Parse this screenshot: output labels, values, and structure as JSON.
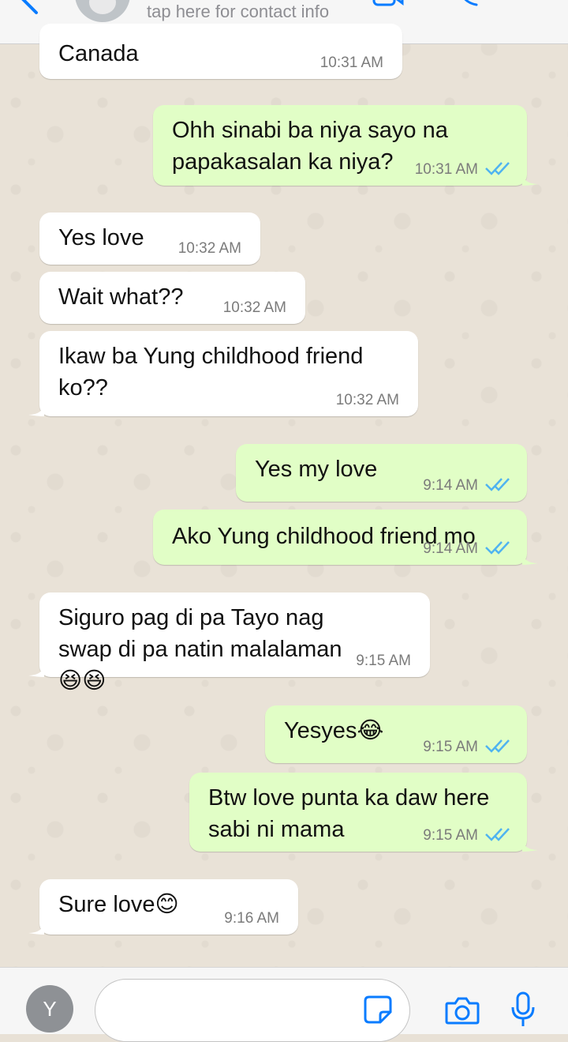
{
  "header": {
    "subtitle": "tap here for contact info",
    "icons": [
      "back-chevron-icon",
      "video-call-icon",
      "phone-call-icon",
      "info-icon"
    ]
  },
  "messages": [
    {
      "dir": "in",
      "text": "Canada",
      "time": "10:31 AM"
    },
    {
      "dir": "out",
      "text": "Ohh sinabi ba niya sayo na papakasalan ka niya?",
      "time": "10:31 AM",
      "status": "read"
    },
    {
      "dir": "in",
      "text": "Yes love",
      "time": "10:32 AM"
    },
    {
      "dir": "in",
      "text": "Wait what??",
      "time": "10:32 AM"
    },
    {
      "dir": "in",
      "text": "Ikaw ba Yung childhood friend ko??",
      "time": "10:32 AM"
    },
    {
      "dir": "out",
      "text": "Yes my love",
      "time": "9:14 AM",
      "status": "read"
    },
    {
      "dir": "out",
      "text": "Ako Yung childhood friend mo",
      "time": "9:14 AM",
      "status": "read"
    },
    {
      "dir": "in",
      "text": "Siguro pag di pa Tayo nag swap di pa natin malalaman😆😆",
      "time": "9:15 AM"
    },
    {
      "dir": "out",
      "text": "Yesyes😂",
      "time": "9:15 AM",
      "status": "read"
    },
    {
      "dir": "out",
      "text": "Btw love punta ka daw here sabi ni mama",
      "time": "9:15 AM",
      "status": "read"
    },
    {
      "dir": "in",
      "text": "Sure love😊",
      "time": "9:16 AM"
    }
  ],
  "composer": {
    "avatar_initial": "Y",
    "input_value": ""
  },
  "colors": {
    "incoming_bubble": "#ffffff",
    "outgoing_bubble": "#e1fec6",
    "read_ticks": "#4fb3f0",
    "accent": "#0a7cff"
  }
}
